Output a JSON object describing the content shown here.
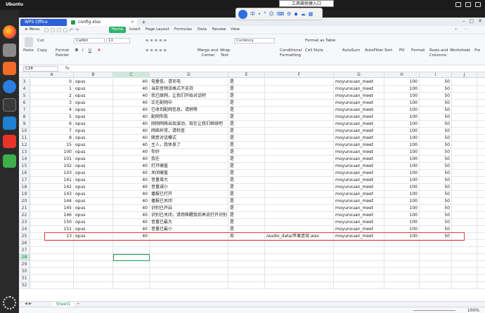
{
  "os": {
    "name": "Ubuntu"
  },
  "ime": {
    "tooltip": "工具箱快捷入口",
    "glyphs": [
      "中",
      "•",
      "°",
      "☺",
      "⌨",
      "⚙",
      "◆",
      "☁",
      "▦",
      "⬚"
    ]
  },
  "dock_icons": [
    "firefox-icon",
    "files-icon",
    "software-icon",
    "help-icon",
    "terminal-icon",
    "vscode-icon",
    "wps-icon",
    "trash-icon",
    "apps-grid-icon"
  ],
  "tabs": {
    "app": "WPS Office",
    "file": "config.xlsx",
    "close": "×",
    "add": "+"
  },
  "window": {
    "min": "–",
    "max": "▢",
    "close": "✕"
  },
  "menu": {
    "menu_btn": "≡ Menu",
    "home": "Home",
    "items": [
      "Insert",
      "Page Layout",
      "Formulas",
      "Data",
      "Review",
      "View"
    ]
  },
  "ribbon": {
    "cut": "Cut",
    "paste": "Paste",
    "copy": "Copy",
    "format_painter_1": "Format",
    "format_painter_2": "Painter",
    "font": "Calibri",
    "size": "11",
    "merge_1": "Merge and",
    "merge_2": "Center",
    "wrap_1": "Wrap",
    "wrap_2": "Text",
    "number_format": "Currency",
    "cond_1": "Conditional",
    "cond_2": "Formatting",
    "format_table": "Format as Table",
    "cell_style": "Cell Style",
    "autosum": "AutoSum",
    "autofilter": "AutoFilter",
    "sort": "Sort",
    "fill": "Fill",
    "format": "Format",
    "rows_1": "Rows and",
    "rows_2": "Columns",
    "worksheet": "Worksheet",
    "freeze": "Fre"
  },
  "formula_bar": {
    "name_box": "C28",
    "fx": "fx"
  },
  "columns": [
    "A",
    "B",
    "C",
    "D",
    "E",
    "F",
    "G",
    "H",
    "I",
    "J"
  ],
  "rows": [
    {
      "n": "3",
      "a": "0",
      "b": "opus",
      "c": "40",
      "d": "电量低，请充电",
      "e": "是",
      "f": "",
      "g": "moyunxuan_meet",
      "h": "100",
      "i": "50"
    },
    {
      "n": "4",
      "a": "1",
      "b": "opus",
      "c": "40",
      "d": "当前音频流格式不支持",
      "e": "是",
      "f": "",
      "g": "moyunxuan_meet",
      "h": "100",
      "i": "50"
    },
    {
      "n": "5",
      "a": "2",
      "b": "opus",
      "c": "40",
      "d": "我已联网，让我们开始对话吧",
      "e": "是",
      "f": "",
      "g": "moyunxuan_meet",
      "h": "100",
      "i": "50"
    },
    {
      "n": "6",
      "a": "3",
      "b": "opus",
      "c": "40",
      "d": "正在配网中",
      "e": "是",
      "f": "",
      "g": "moyunxuan_meet",
      "h": "100",
      "i": "50"
    },
    {
      "n": "7",
      "a": "4",
      "b": "opus",
      "c": "40",
      "d": "已收到配网信息，请稍等",
      "e": "是",
      "f": "",
      "g": "moyunxuan_meet",
      "h": "100",
      "i": "50"
    },
    {
      "n": "8",
      "a": "5",
      "b": "opus",
      "c": "40",
      "d": "配网失败",
      "e": "是",
      "f": "",
      "g": "moyunxuan_meet",
      "h": "100",
      "i": "50"
    },
    {
      "n": "9",
      "a": "6",
      "b": "opus",
      "c": "40",
      "d": "刚刚网络出现波动，现在让我们继续吧",
      "e": "是",
      "f": "",
      "g": "moyunxuan_meet",
      "h": "100",
      "i": "50"
    },
    {
      "n": "10",
      "a": "7",
      "b": "opus",
      "c": "40",
      "d": "网络异常，请检查",
      "e": "是",
      "f": "",
      "g": "moyunxuan_meet",
      "h": "100",
      "i": "50"
    },
    {
      "n": "11",
      "a": "8",
      "b": "opus",
      "c": "40",
      "d": "随意对话模式",
      "e": "是",
      "f": "",
      "g": "moyunxuan_meet",
      "h": "100",
      "i": "50"
    },
    {
      "n": "12",
      "a": "15",
      "b": "opus",
      "c": "40",
      "d": "主人，我休息了",
      "e": "是",
      "f": "",
      "g": "moyunxuan_meet",
      "h": "100",
      "i": "50"
    },
    {
      "n": "13",
      "a": "100",
      "b": "opus",
      "c": "40",
      "d": "你好",
      "e": "是",
      "f": "",
      "g": "moyunxuan_meet",
      "h": "100",
      "i": "50"
    },
    {
      "n": "14",
      "a": "101",
      "b": "opus",
      "c": "40",
      "d": "我在",
      "e": "是",
      "f": "",
      "g": "moyunxuan_meet",
      "h": "100",
      "i": "50"
    },
    {
      "n": "15",
      "a": "102",
      "b": "opus",
      "c": "40",
      "d": "打开硬盖",
      "e": "是",
      "f": "",
      "g": "moyunxuan_meet",
      "h": "100",
      "i": "50"
    },
    {
      "n": "16",
      "a": "103",
      "b": "opus",
      "c": "40",
      "d": "关闭硬盖",
      "e": "是",
      "f": "",
      "g": "moyunxuan_meet",
      "h": "100",
      "i": "50"
    },
    {
      "n": "17",
      "a": "141",
      "b": "opus",
      "c": "40",
      "d": "音量增大",
      "e": "是",
      "f": "",
      "g": "moyunxuan_meet",
      "h": "100",
      "i": "50"
    },
    {
      "n": "18",
      "a": "142",
      "b": "opus",
      "c": "40",
      "d": "音量减小",
      "e": "是",
      "f": "",
      "g": "moyunxuan_meet",
      "h": "100",
      "i": "50"
    },
    {
      "n": "19",
      "a": "143",
      "b": "opus",
      "c": "40",
      "d": "播报已打开",
      "e": "是",
      "f": "",
      "g": "moyunxuan_meet",
      "h": "100",
      "i": "50"
    },
    {
      "n": "20",
      "a": "144",
      "b": "opus",
      "c": "40",
      "d": "播报已关闭",
      "e": "是",
      "f": "",
      "g": "moyunxuan_meet",
      "h": "100",
      "i": "50"
    },
    {
      "n": "21",
      "a": "145",
      "b": "opus",
      "c": "40",
      "d": "识别已开启",
      "e": "是",
      "f": "",
      "g": "moyunxuan_meet",
      "h": "100",
      "i": "50"
    },
    {
      "n": "22",
      "a": "146",
      "b": "opus",
      "c": "40",
      "d": "识别已关闭，请用唤醒我后再说打开识别",
      "e": "是",
      "f": "",
      "g": "moyunxuan_meet",
      "h": "100",
      "i": "50"
    },
    {
      "n": "23",
      "a": "150",
      "b": "opus",
      "c": "40",
      "d": "音量已最大",
      "e": "是",
      "f": "",
      "g": "moyunxuan_meet",
      "h": "100",
      "i": "50"
    },
    {
      "n": "24",
      "a": "151",
      "b": "opus",
      "c": "40",
      "d": "音量已最小",
      "e": "是",
      "f": "",
      "g": "moyunxuan_meet",
      "h": "100",
      "i": "50"
    },
    {
      "n": "25",
      "a": "13",
      "b": "opus",
      "c": "40",
      "d": "",
      "e": "否",
      "f": "/audio_data/苹果音效.wav",
      "g": "moyunxuan_meet",
      "h": "100",
      "i": "50"
    },
    {
      "n": "26",
      "a": "",
      "b": "",
      "c": "",
      "d": "",
      "e": "",
      "f": "",
      "g": "",
      "h": "",
      "i": ""
    },
    {
      "n": "27",
      "a": "",
      "b": "",
      "c": "",
      "d": "",
      "e": "",
      "f": "",
      "g": "",
      "h": "",
      "i": ""
    },
    {
      "n": "28",
      "a": "",
      "b": "",
      "c": "",
      "d": "",
      "e": "",
      "f": "",
      "g": "",
      "h": "",
      "i": ""
    },
    {
      "n": "29",
      "a": "",
      "b": "",
      "c": "",
      "d": "",
      "e": "",
      "f": "",
      "g": "",
      "h": "",
      "i": ""
    },
    {
      "n": "30",
      "a": "",
      "b": "",
      "c": "",
      "d": "",
      "e": "",
      "f": "",
      "g": "",
      "h": "",
      "i": ""
    },
    {
      "n": "31",
      "a": "",
      "b": "",
      "c": "",
      "d": "",
      "e": "",
      "f": "",
      "g": "",
      "h": "",
      "i": ""
    },
    {
      "n": "32",
      "a": "",
      "b": "",
      "c": "",
      "d": "",
      "e": "",
      "f": "",
      "g": "",
      "h": "",
      "i": ""
    }
  ],
  "sheet_tab": "Sheet1",
  "status": {
    "zoom": "100%"
  },
  "colors": {
    "accent": "#1f9c4a",
    "wps_blue": "#2e5fd6",
    "highlight": "#e23b3b"
  }
}
